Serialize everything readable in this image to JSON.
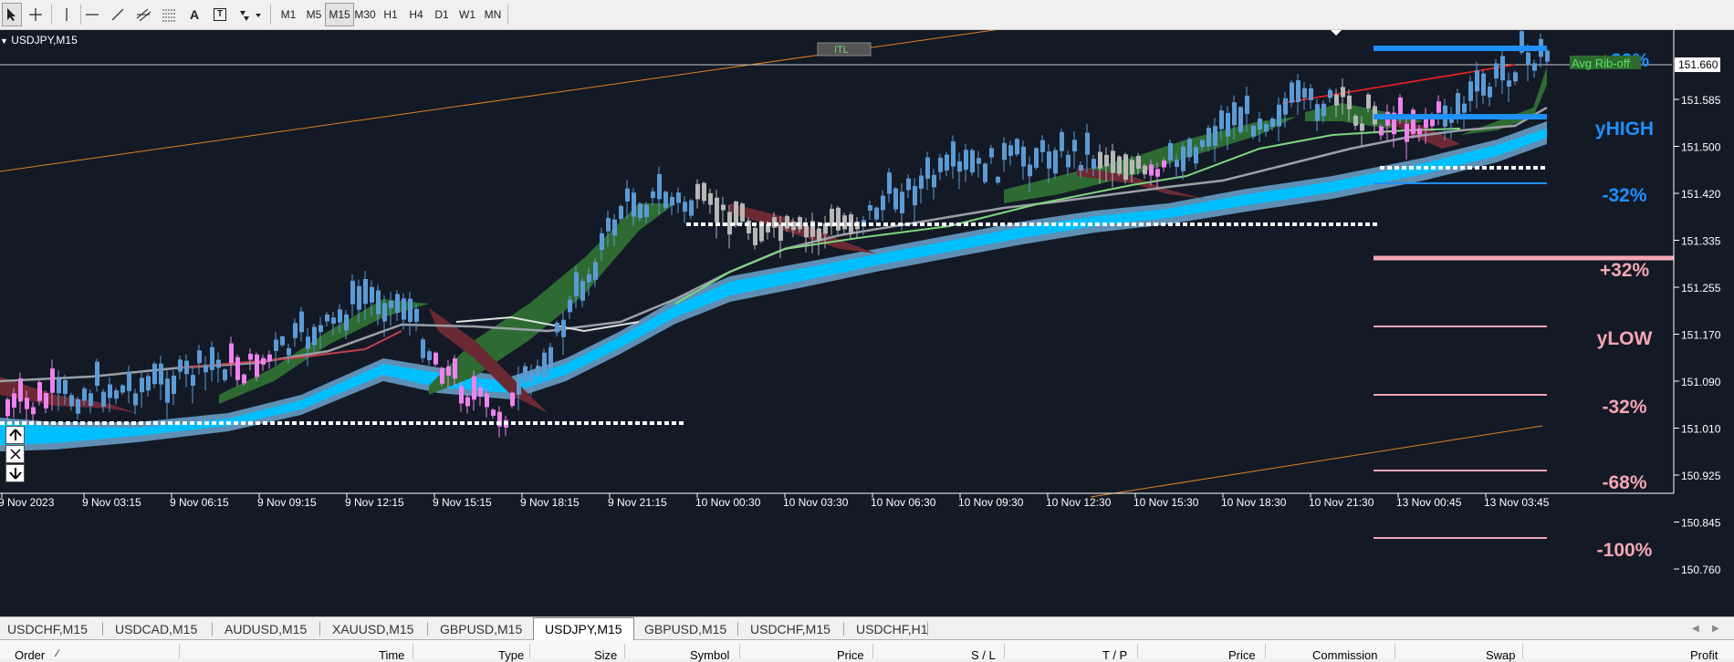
{
  "toolbar": {
    "tools": [
      {
        "icon": "cursor-arrow-icon"
      },
      {
        "icon": "crosshair-icon"
      },
      {
        "icon": "vertical-line-icon"
      },
      {
        "icon": "horizontal-line-icon"
      },
      {
        "icon": "trendline-icon"
      },
      {
        "icon": "equidistant-channel-icon"
      },
      {
        "icon": "fibonacci-icon"
      },
      {
        "icon": "text-icon",
        "label": "A"
      },
      {
        "icon": "text-label-icon",
        "label": "T"
      },
      {
        "icon": "shapes-dropdown-icon"
      }
    ],
    "timeframes": [
      "M1",
      "M5",
      "M15",
      "M30",
      "H1",
      "H4",
      "D1",
      "W1",
      "MN"
    ],
    "selected_timeframe": "M15"
  },
  "chart": {
    "symbol": "USDJPY,M15",
    "current_price": "151.660",
    "itl_label": "ITL",
    "avg_label": "Avg Rib-off",
    "price_axis": [
      "151.585",
      "151.500",
      "151.420",
      "151.335",
      "151.255",
      "151.170",
      "151.090",
      "151.010",
      "150.925",
      "150.845",
      "150.760"
    ],
    "time_axis": [
      "9 Nov 2023",
      "9 Nov 03:15",
      "9 Nov 06:15",
      "9 Nov 09:15",
      "9 Nov 12:15",
      "9 Nov 15:15",
      "9 Nov 18:15",
      "9 Nov 21:15",
      "10 Nov 00:30",
      "10 Nov 03:30",
      "10 Nov 06:30",
      "10 Nov 09:30",
      "10 Nov 12:30",
      "10 Nov 15:30",
      "10 Nov 18:30",
      "10 Nov 21:30",
      "13 Nov 00:45",
      "13 Nov 03:45"
    ],
    "levels": [
      {
        "label": "+32%",
        "color": "#1e90ff"
      },
      {
        "label": "yHIGH",
        "color": "#1e90ff"
      },
      {
        "label": "-32%",
        "color": "#1e90ff"
      },
      {
        "label": "+32%",
        "color": "#f4a6b4"
      },
      {
        "label": "yLOW",
        "color": "#f4a6b4"
      },
      {
        "label": "-32%",
        "color": "#f4a6b4"
      },
      {
        "label": "-68%",
        "color": "#f4a6b4"
      },
      {
        "label": "-100%",
        "color": "#f4a6b4"
      }
    ],
    "colors": {
      "background": "#131a26",
      "candle_up": "#5b9bd5",
      "candle_down_pink": "#ee82ee",
      "ribbon_fast_bull": "#2e6b32",
      "ribbon_fast_bear": "#6b2a33",
      "ribbon_slow": "#00bfff",
      "fast_ma": "#9aa0a6",
      "slow_ma": "#5f8fb4",
      "trend_line": "#e08020",
      "red_line": "#ff2020"
    }
  },
  "nav_buttons": [
    {
      "icon": "arrow-up-icon",
      "label": "⏶"
    },
    {
      "icon": "close-icon",
      "label": "✕"
    },
    {
      "icon": "arrow-down-icon",
      "label": "⏷"
    }
  ],
  "tabs": [
    "USDCHF,M15",
    "USDCAD,M15",
    "AUDUSD,M15",
    "XAUUSD,M15",
    "GBPUSD,M15",
    "USDJPY,M15",
    "GBPUSD,M15",
    "USDCHF,M15",
    "USDCHF,H1"
  ],
  "active_tab": "USDJPY,M15",
  "table_headers": [
    "Order",
    "Time",
    "Type",
    "Size",
    "Symbol",
    "Price",
    "S / L",
    "T / P",
    "Price",
    "Commission",
    "Swap",
    "Profit"
  ]
}
